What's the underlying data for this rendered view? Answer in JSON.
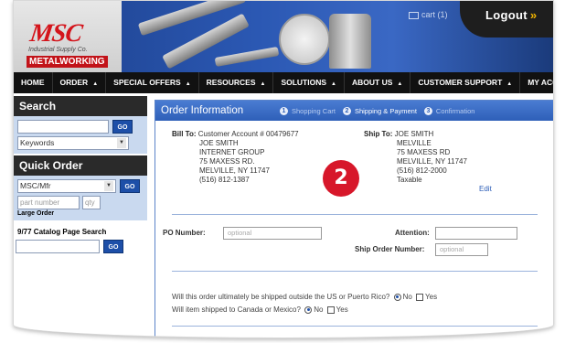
{
  "header": {
    "logo_text": "MSC",
    "logo_sub": "Industrial Supply Co.",
    "logo_brand": "METALWORKING",
    "cart_label": "cart (1)",
    "logout_label": "Logout",
    "logout_chev": "»"
  },
  "nav": {
    "items": [
      "HOME",
      "ORDER",
      "SPECIAL OFFERS",
      "RESOURCES",
      "SOLUTIONS",
      "ABOUT US",
      "CUSTOMER SUPPORT",
      "MY ACCOUNT"
    ]
  },
  "sidebar": {
    "search_title": "Search",
    "search_input": "",
    "search_go": "GO",
    "search_type": "Keywords",
    "quick_order_title": "Quick Order",
    "quick_order_select": "MSC/Mfr",
    "quick_order_go": "GO",
    "part_number_placeholder": "part number",
    "qty_placeholder": "qty",
    "large_order": "Large Order",
    "catalog_title": "9/77 Catalog Page Search",
    "catalog_go": "GO"
  },
  "order": {
    "title": "Order Information",
    "steps": [
      {
        "num": "1",
        "label": "Shopping Cart"
      },
      {
        "num": "2",
        "label": "Shipping & Payment"
      },
      {
        "num": "3",
        "label": "Confirmation"
      }
    ],
    "bill_to_label": "Bill To:",
    "bill_to_lines": [
      "Customer Account # 00479677",
      "JOE SMITH",
      "INTERNET GROUP",
      "75 MAXESS RD.",
      "MELVILLE, NY 11747",
      "(516) 812-1387"
    ],
    "ship_to_label": "Ship To:",
    "ship_to_lines": [
      "JOE SMITH",
      "MELVILLE",
      "75 MAXESS RD",
      "MELVILLE, NY 11747",
      "(516) 812-2000",
      "Taxable"
    ],
    "edit_label": "Edit",
    "po_label": "PO Number:",
    "po_placeholder": "optional",
    "attention_label": "Attention:",
    "ship_order_label": "Ship Order Number:",
    "ship_order_placeholder": "optional",
    "q1": "Will this order ultimately be shipped outside the US or Puerto Rico?",
    "q2": "Will item shipped to Canada or Mexico?",
    "no_label": "No",
    "yes_label": "Yes",
    "badge": "2"
  },
  "colors": {
    "brand_red": "#d4141b",
    "nav_bg": "#111111",
    "accent_blue": "#2e5fb8",
    "sidebar_bg": "#c9d9ef"
  }
}
